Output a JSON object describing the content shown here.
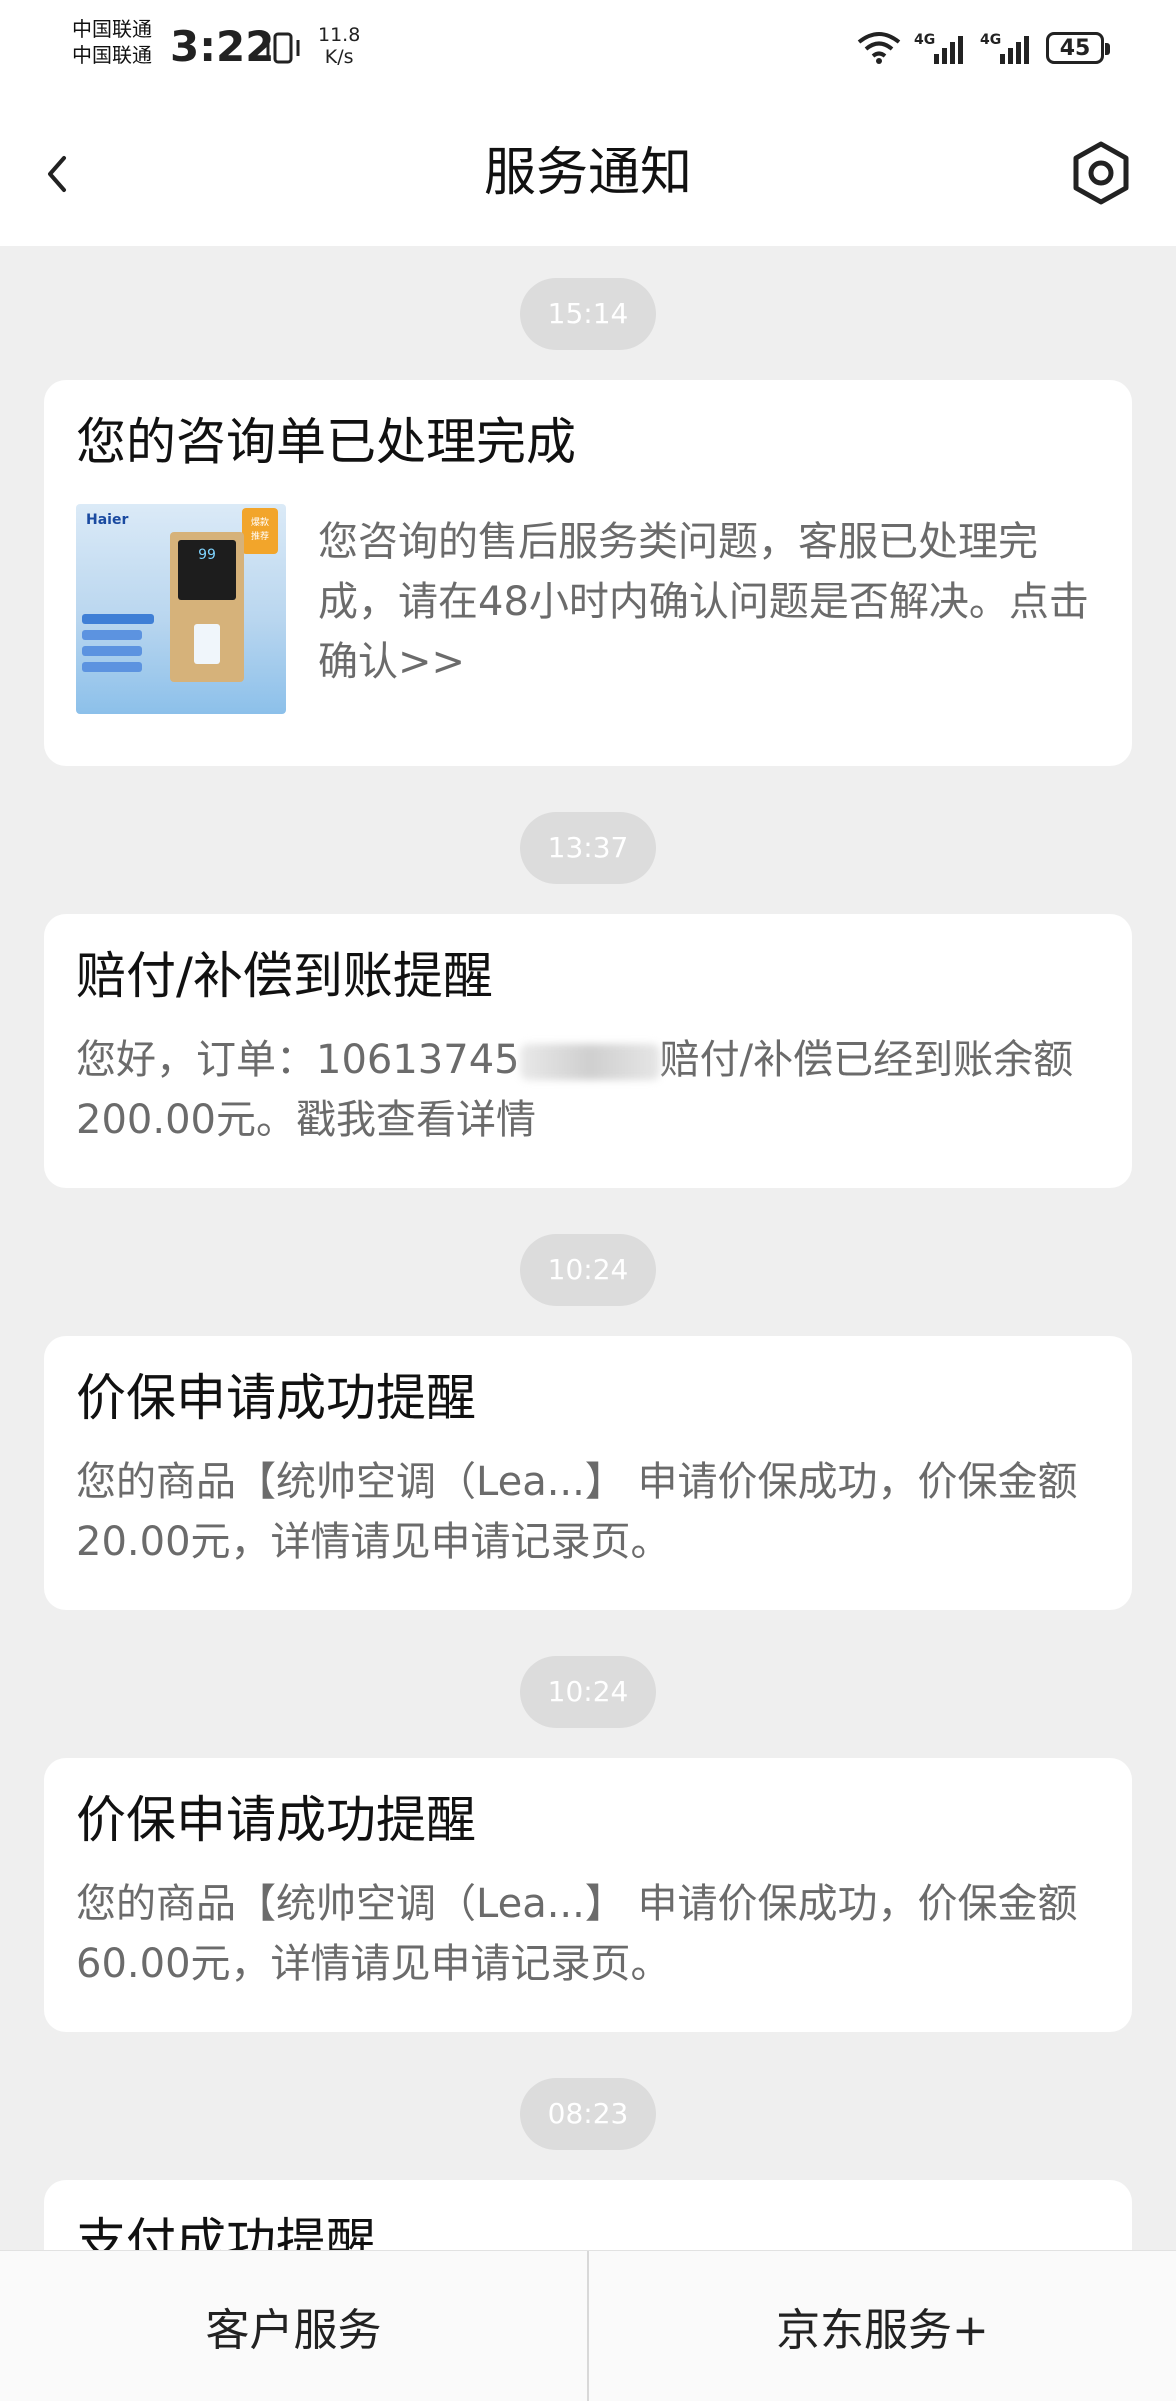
{
  "status_bar": {
    "carrier_1": "中国联通",
    "carrier_2": "中国联通",
    "time": "3:22",
    "speed_value": "11.8",
    "speed_unit": "K/s",
    "network_1": "4G",
    "network_2": "4G",
    "battery": "45"
  },
  "nav": {
    "title": "服务通知"
  },
  "messages": [
    {
      "time": "15:14",
      "title": "您的咨询单已处理完成",
      "body": "您咨询的售后服务类问题，客服已处理完成，请在48小时内确认问题是否解决。点击确认>>",
      "thumb_brand": "Haier",
      "thumb_badge": "爆款\n推荐",
      "thumb_display": "99"
    },
    {
      "time": "13:37",
      "title": "赔付/补偿到账提醒",
      "body_prefix": "您好，订单：10613745",
      "body_suffix": "赔付/补偿已经到账余额200.00元。戳我查看详情"
    },
    {
      "time": "10:24",
      "title": "价保申请成功提醒",
      "body": "您的商品【统帅空调（Lea...】 申请价保成功，价保金额20.00元，详情请见申请记录页。"
    },
    {
      "time": "10:24",
      "title": "价保申请成功提醒",
      "body": "您的商品【统帅空调（Lea...】 申请价保成功，价保金额60.00元，详情请见申请记录页。"
    },
    {
      "time": "08:23",
      "title": "支付成功提醒"
    }
  ],
  "bottom_bar": {
    "left": "客户服务",
    "right": "京东服务+"
  },
  "icons": {
    "back": "chevron-left-icon",
    "settings": "settings-hexagon-icon"
  },
  "colors": {
    "background": "#efefef",
    "card": "#ffffff",
    "time_pill": "#dcdcdc",
    "body_text": "#6b6b6b"
  }
}
